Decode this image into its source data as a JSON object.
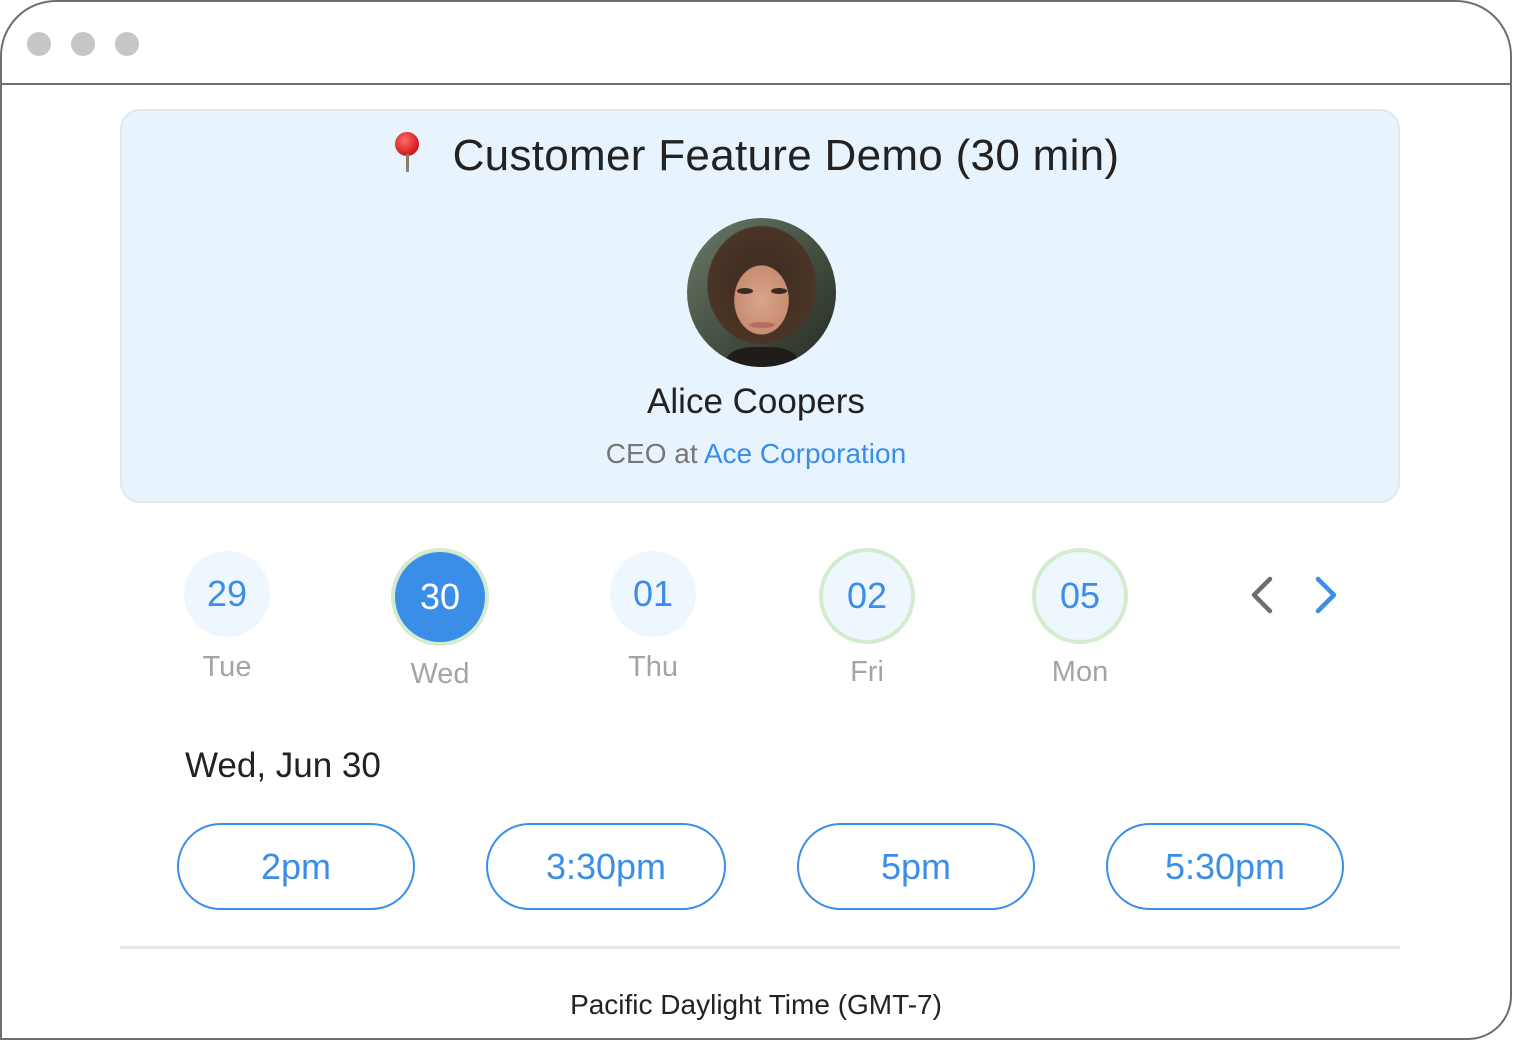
{
  "window": {
    "controls": [
      "close",
      "minimize",
      "maximize"
    ]
  },
  "event": {
    "icon": "round-pushpin-icon",
    "title": "Customer Feature Demo (30 min)"
  },
  "host": {
    "avatar": "host-photo",
    "name": "Alice Coopers",
    "role_prefix": "CEO at",
    "company": "Ace Corporation"
  },
  "days": [
    {
      "date": "29",
      "weekday": "Tue",
      "state": "unavailable"
    },
    {
      "date": "30",
      "weekday": "Wed",
      "state": "selected"
    },
    {
      "date": "01",
      "weekday": "Thu",
      "state": "unavailable"
    },
    {
      "date": "02",
      "weekday": "Fri",
      "state": "available"
    },
    {
      "date": "05",
      "weekday": "Mon",
      "state": "available"
    }
  ],
  "navigation": {
    "prev_icon": "chevron-left-icon",
    "next_icon": "chevron-right-icon"
  },
  "selected_date": "Wed, Jun 30",
  "time_slots": [
    "2pm",
    "3:30pm",
    "5pm",
    "5:30pm"
  ],
  "timezone": "Pacific Daylight Time (GMT-7)",
  "colors": {
    "accent": "#3a8ee8",
    "card_bg": "#e7f3fd",
    "available_ring": "#d3ecd0",
    "muted_text": "#a4a4a4"
  }
}
